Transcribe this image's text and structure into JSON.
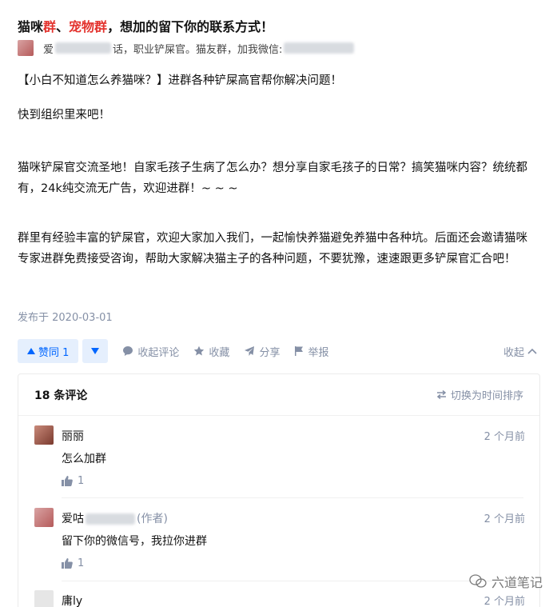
{
  "post": {
    "title_part1": "猫咪",
    "title_part2": "群",
    "title_part3": "、",
    "title_part4": "宠物群",
    "title_part5": "，想加的留下你的联系方式！",
    "author_name_start": "爱",
    "author_bio_mid": "话，职业铲屎官。猫友群，加我微信:",
    "paragraphs": [
      "【小白不知道怎么养猫咪？】进群各种铲屎高官帮你解决问题！",
      "快到组织里来吧！",
      "猫咪铲屎官交流圣地！自家毛孩子生病了怎么办？想分享自家毛孩子的日常？搞笑猫咪内容？统统都有，24k纯交流无广告，欢迎进群！~ ~ ~",
      "群里有经验丰富的铲屎官，欢迎大家加入我们，一起愉快养猫避免养猫中各种坑。后面还会邀请猫咪专家进群免费接受咨询，帮助大家解决猫主子的各种问题，不要犹豫，速速跟更多铲屎官汇合吧！"
    ],
    "published": "发布于 2020-03-01"
  },
  "actions": {
    "upvote": "赞同 1",
    "collapse_comments": "收起评论",
    "favorite": "收藏",
    "share": "分享",
    "report": "举报",
    "collapse": "收起"
  },
  "comments": {
    "count_label": "18 条评论",
    "sort_label": "切换为时间排序",
    "items": [
      {
        "name": "丽丽",
        "tag": "",
        "time": "2 个月前",
        "text": "怎么加群",
        "likes": "1"
      },
      {
        "name": "爱咕",
        "tag": "(作者)",
        "time": "2 个月前",
        "text": "留下你的微信号，我拉你进群",
        "likes": "1"
      },
      {
        "name": "庸ly",
        "tag": "",
        "time": "2 个月前",
        "text": "",
        "likes": ""
      }
    ]
  },
  "watermark": "六道笔记",
  "colors": {
    "accent": "#0066ff",
    "title_red": "#e3322d",
    "muted": "#8590a6"
  }
}
